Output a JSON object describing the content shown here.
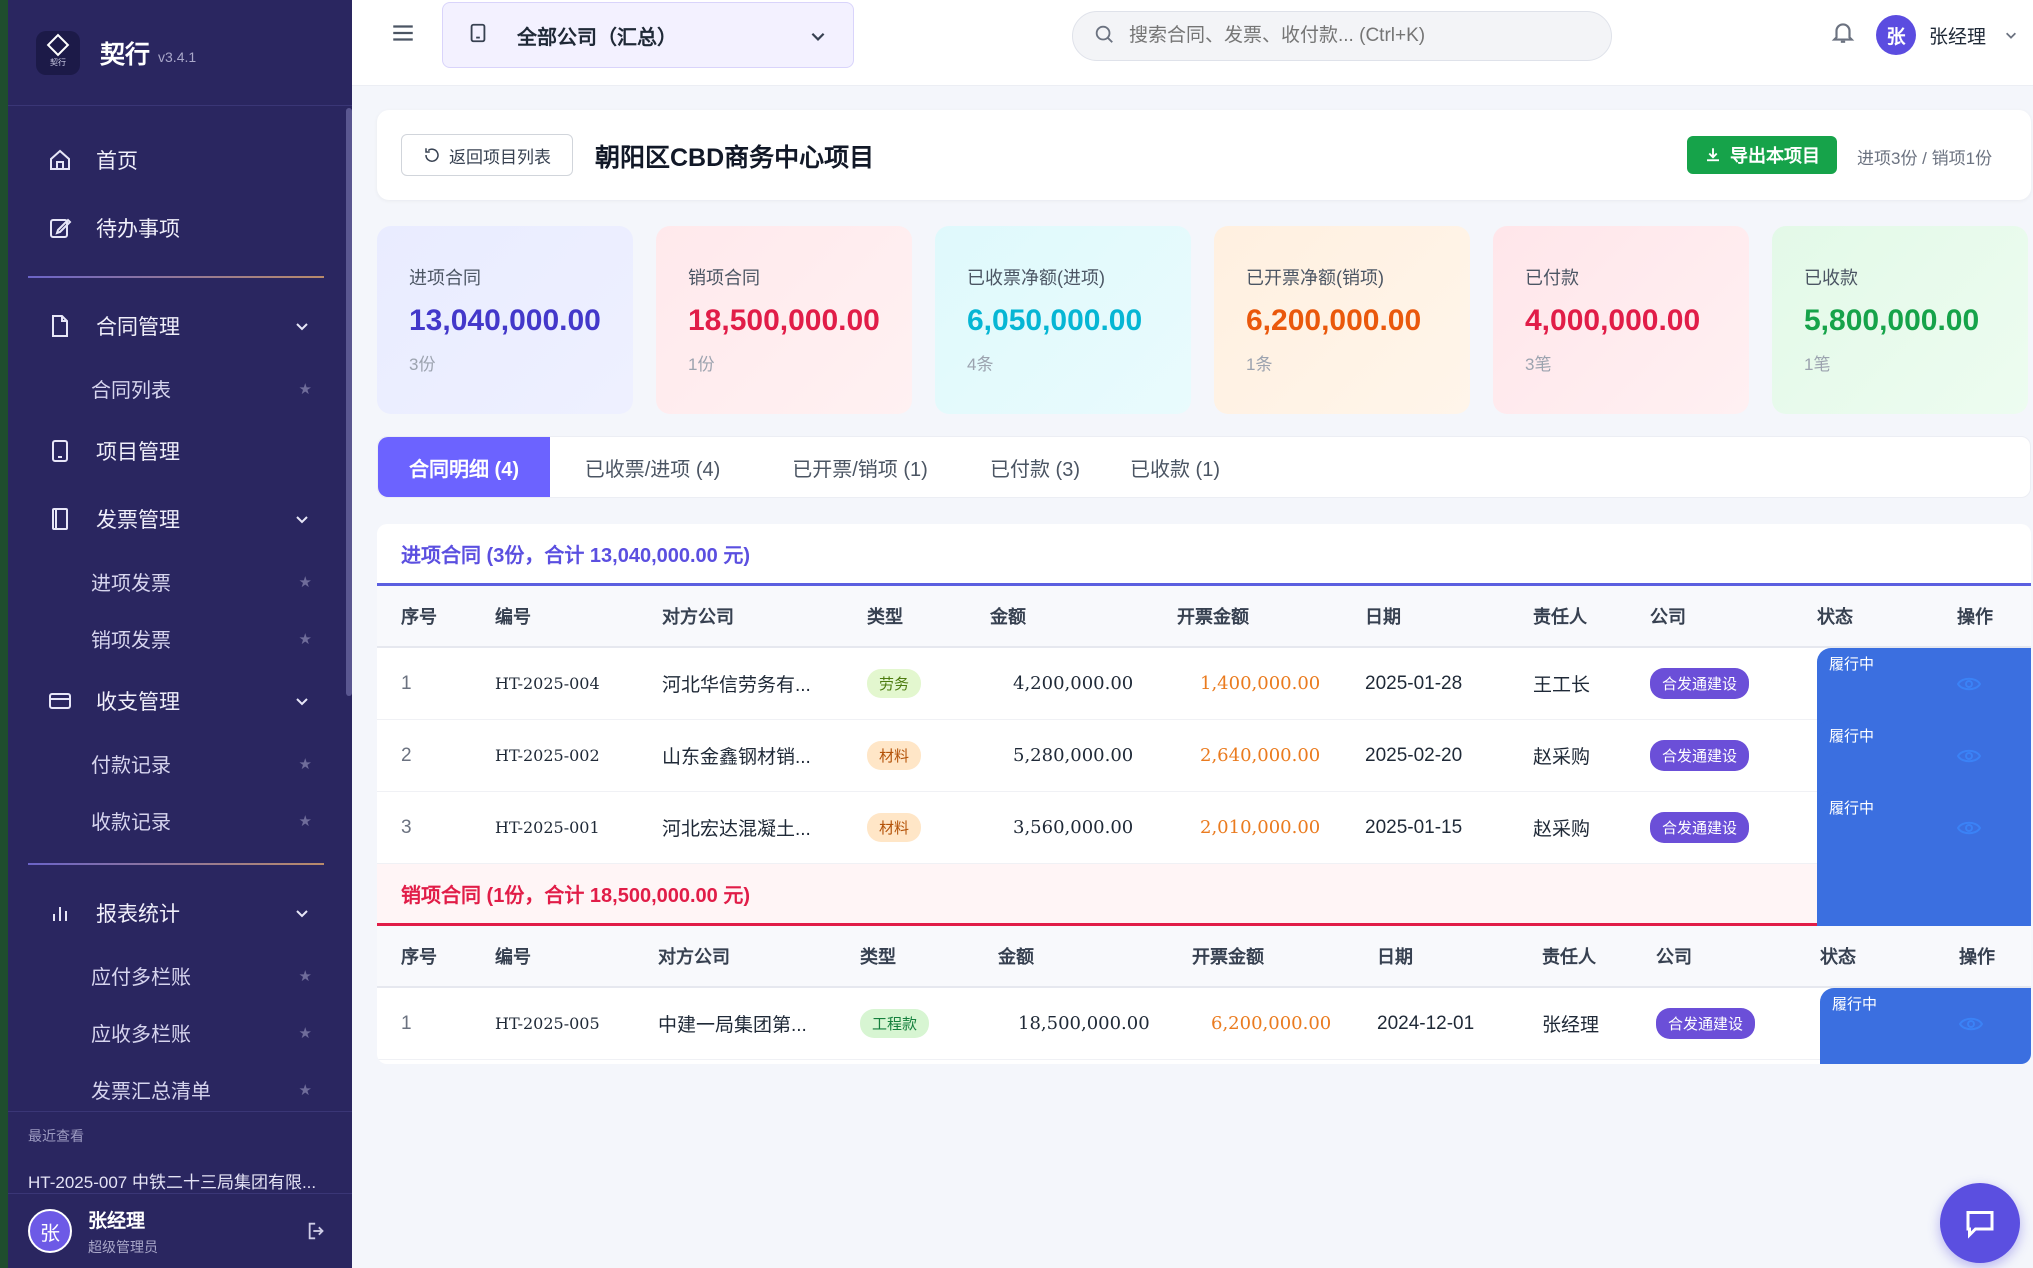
{
  "brand": {
    "name": "契行",
    "version": "v3.4.1",
    "logo_small": "契行"
  },
  "sidebar": {
    "items": [
      {
        "label": "首页",
        "icon": "home-icon"
      },
      {
        "label": "待办事项",
        "icon": "edit-icon"
      }
    ],
    "groups": [
      {
        "label": "合同管理",
        "icon": "document-icon",
        "subs": [
          "合同列表"
        ]
      },
      {
        "label": "项目管理",
        "icon": "tablet-icon",
        "subs": []
      },
      {
        "label": "发票管理",
        "icon": "invoice-icon",
        "subs": [
          "进项发票",
          "销项发票"
        ]
      },
      {
        "label": "收支管理",
        "icon": "card-icon",
        "subs": [
          "付款记录",
          "收款记录"
        ]
      },
      {
        "label": "报表统计",
        "icon": "chart-icon",
        "subs": [
          "应付多栏账",
          "应收多栏账",
          "发票汇总清单"
        ]
      }
    ],
    "recent_title": "最近查看",
    "recent_item": "HT-2025-007 中铁二十三局集团有限...",
    "user": {
      "avatar": "张",
      "name": "张经理",
      "role": "超级管理员"
    }
  },
  "header": {
    "company": "全部公司（汇总）",
    "search_placeholder": "搜索合同、发票、收付款... (Ctrl+K)",
    "avatar": "张",
    "user_name": "张经理"
  },
  "project": {
    "back_label": "返回项目列表",
    "title": "朝阳区CBD商务中心项目",
    "export_label": "导出本项目",
    "count_text": "进项3份 / 销项1份"
  },
  "stats": [
    {
      "label": "进项合同",
      "value": "13,040,000.00",
      "sub": "3份",
      "color": "#4338ca"
    },
    {
      "label": "销项合同",
      "value": "18,500,000.00",
      "sub": "1份",
      "color": "#e11d48"
    },
    {
      "label": "已收票净额(进项)",
      "value": "6,050,000.00",
      "sub": "4条",
      "color": "#06b6d4"
    },
    {
      "label": "已开票净额(销项)",
      "value": "6,200,000.00",
      "sub": "1条",
      "color": "#ea580c"
    },
    {
      "label": "已付款",
      "value": "4,000,000.00",
      "sub": "3笔",
      "color": "#e11d48"
    },
    {
      "label": "已收款",
      "value": "5,800,000.00",
      "sub": "1笔",
      "color": "#16a34a"
    }
  ],
  "tabs": [
    "合同明细 (4)",
    "已收票/进项 (4)",
    "已开票/销项 (1)",
    "已付款 (3)",
    "已收款 (1)"
  ],
  "columns": [
    "序号",
    "编号",
    "对方公司",
    "类型",
    "金额",
    "开票金额",
    "日期",
    "责任人",
    "公司",
    "状态",
    "操作"
  ],
  "inbound": {
    "title": "进项合同 (3份，合计 13,040,000.00 元)",
    "rows": [
      {
        "no": "1",
        "code": "HT-2025-004",
        "party": "河北华信劳务有...",
        "type": "劳务",
        "amount": "4,200,000.00",
        "invoiced": "1,400,000.00",
        "date": "2025-01-28",
        "owner": "王工长",
        "company": "合发通建设",
        "status": "履行中"
      },
      {
        "no": "2",
        "code": "HT-2025-002",
        "party": "山东金鑫钢材销...",
        "type": "材料",
        "amount": "5,280,000.00",
        "invoiced": "2,640,000.00",
        "date": "2025-02-20",
        "owner": "赵采购",
        "company": "合发通建设",
        "status": "履行中"
      },
      {
        "no": "3",
        "code": "HT-2025-001",
        "party": "河北宏达混凝土...",
        "type": "材料",
        "amount": "3,560,000.00",
        "invoiced": "2,010,000.00",
        "date": "2025-01-15",
        "owner": "赵采购",
        "company": "合发通建设",
        "status": "履行中"
      }
    ]
  },
  "outbound": {
    "title": "销项合同 (1份，合计 18,500,000.00 元)",
    "rows": [
      {
        "no": "1",
        "code": "HT-2025-005",
        "party": "中建一局集团第...",
        "type": "工程款",
        "amount": "18,500,000.00",
        "invoiced": "6,200,000.00",
        "date": "2024-12-01",
        "owner": "张经理",
        "company": "合发通建设",
        "status": "履行中"
      }
    ]
  }
}
